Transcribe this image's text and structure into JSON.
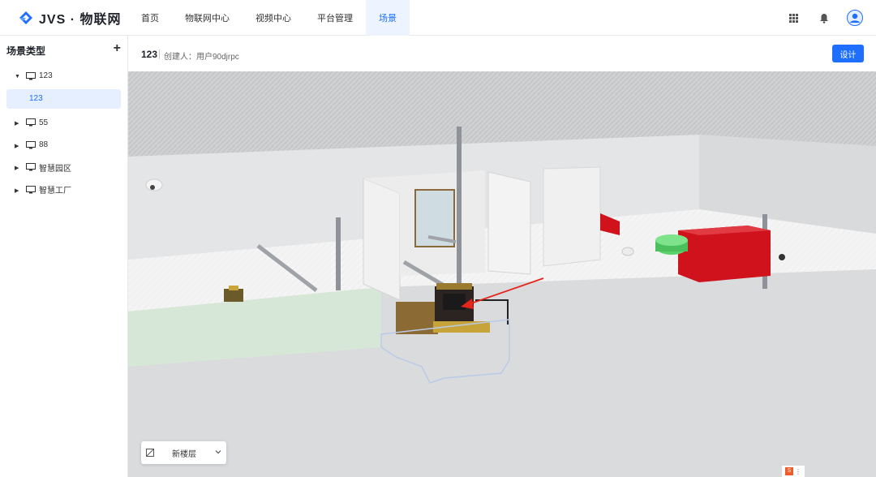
{
  "brand": {
    "name": "JVS · 物联网"
  },
  "nav": [
    {
      "label": "首页",
      "active": false
    },
    {
      "label": "物联网中心",
      "active": false
    },
    {
      "label": "视频中心",
      "active": false
    },
    {
      "label": "平台管理",
      "active": false
    },
    {
      "label": "场景",
      "active": true
    }
  ],
  "top_icons": [
    "apps-grid-icon",
    "bell-icon",
    "user-avatar-icon"
  ],
  "sidebar": {
    "title": "场景类型",
    "add_icon": "plus-icon",
    "tree": [
      {
        "label": "123",
        "expanded": true,
        "children": [
          {
            "label": "123",
            "selected": true
          }
        ]
      },
      {
        "label": "55",
        "expanded": false
      },
      {
        "label": "88",
        "expanded": false
      },
      {
        "label": "智慧园区",
        "expanded": false
      },
      {
        "label": "智慧工厂",
        "expanded": false
      }
    ]
  },
  "scene_header": {
    "title": "123",
    "creator": "创建人：用户90djrpc",
    "design_button": "设计"
  },
  "scene": {
    "floor_selector": {
      "value": "新楼层"
    }
  },
  "colors": {
    "accent": "#1e6fff",
    "tree_selected_bg": "#e6efff",
    "red_object": "#d0121c",
    "green_object": "#5bd36a"
  }
}
